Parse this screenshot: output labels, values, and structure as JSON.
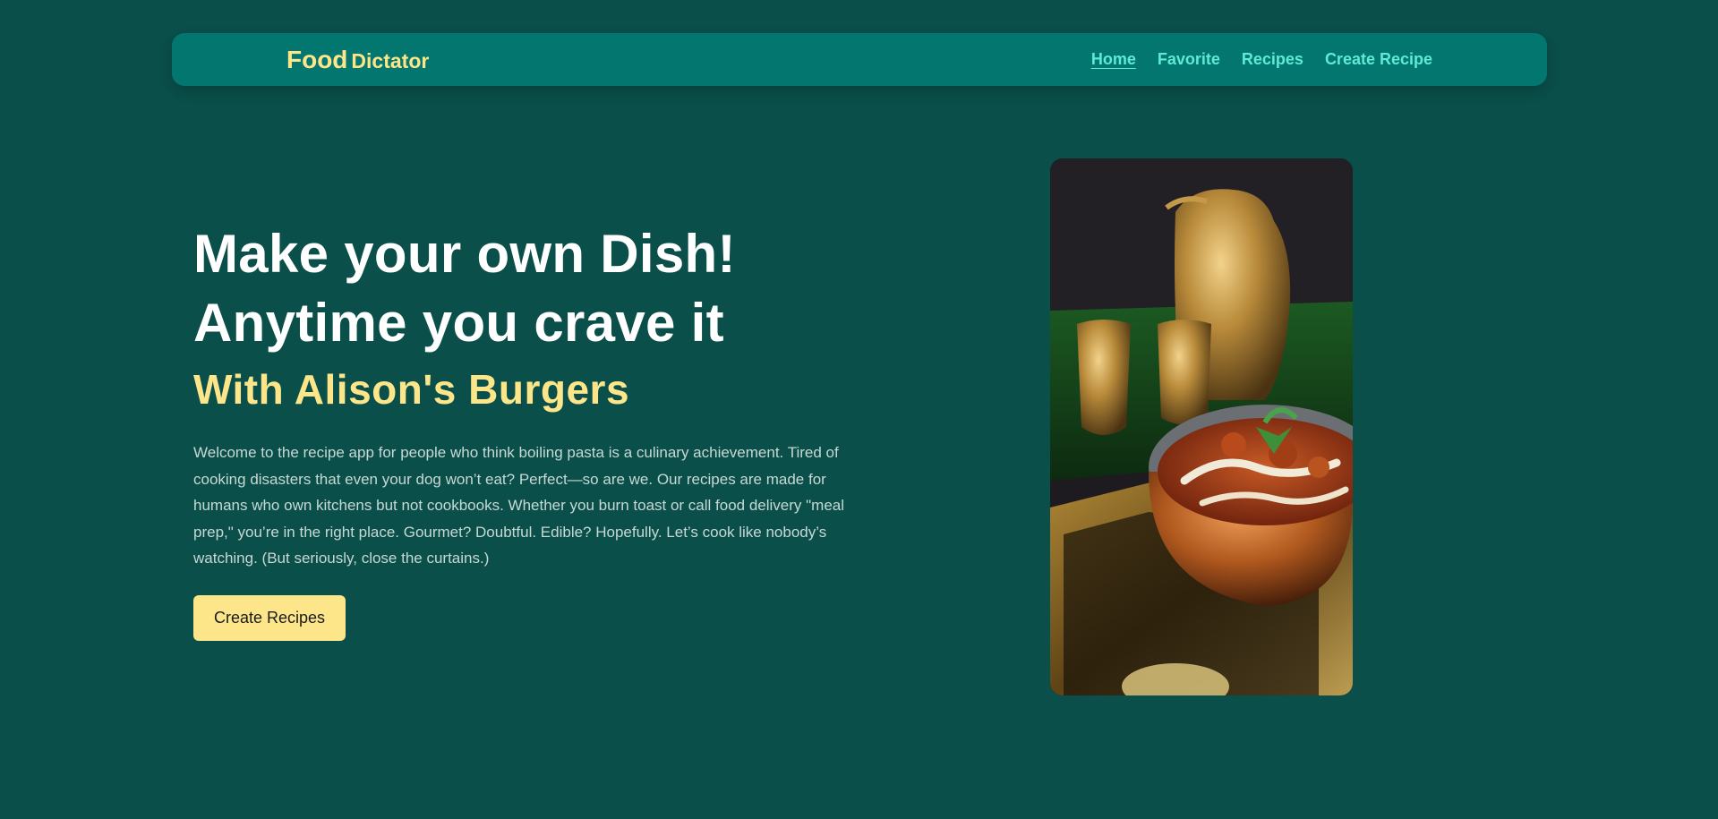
{
  "nav": {
    "logo_main": "Food",
    "logo_sub": "Dictator",
    "links": [
      {
        "label": "Home",
        "active": true
      },
      {
        "label": "Favorite",
        "active": false
      },
      {
        "label": "Recipes",
        "active": false
      },
      {
        "label": "Create Recipe",
        "active": false
      }
    ]
  },
  "hero": {
    "title_line1": "Make your own Dish!",
    "title_line2": "Anytime you crave it",
    "subtitle": "With Alison's Burgers",
    "description": "Welcome to the recipe app for people who think boiling pasta is a culinary achievement. Tired of cooking disasters that even your dog won’t eat? Perfect—so are we. Our recipes are made for humans who own kitchens but not cookbooks. Whether you burn toast or call food delivery \"meal prep,\" you’re in the right place. Gourmet? Doubtful. Edible? Hopefully. Let’s cook like nobody’s watching. (But seriously, close the curtains.)",
    "cta_label": "Create Recipes",
    "image_subject": "curry-dish-photo"
  },
  "colors": {
    "background": "#0a4f4a",
    "navbar": "#047670",
    "accent_yellow": "#fde68a",
    "nav_link": "#5eead4"
  }
}
